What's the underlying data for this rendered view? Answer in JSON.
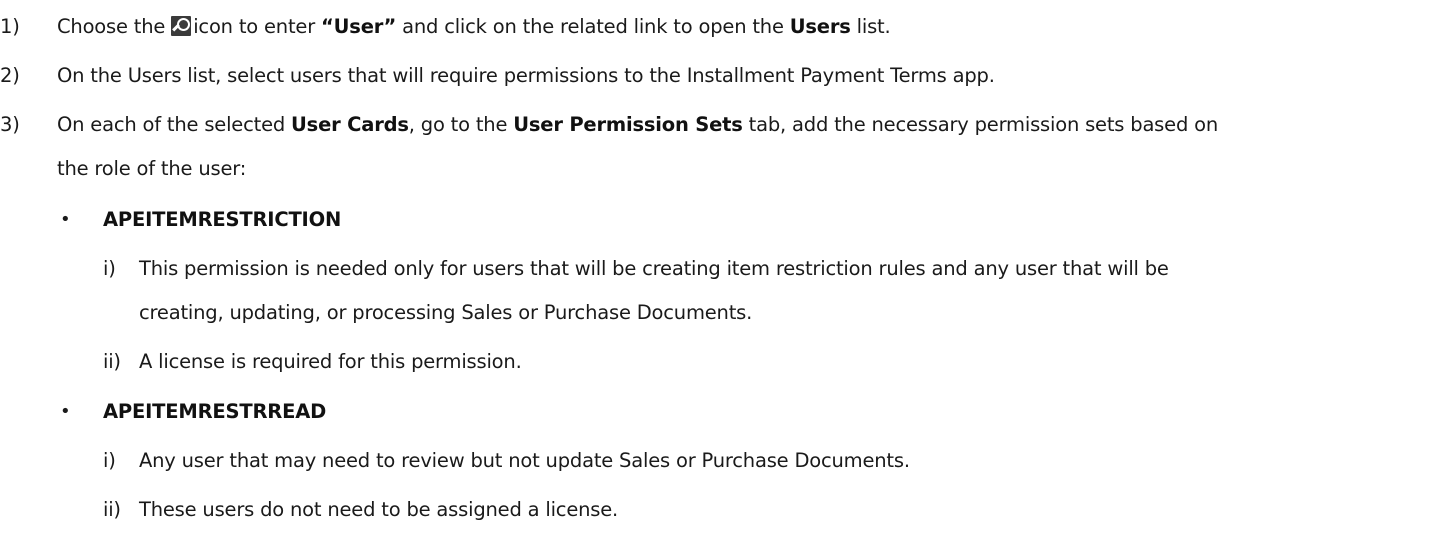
{
  "steps": {
    "s1": {
      "number": "1)",
      "t1": "Choose the",
      "icon": "search-icon",
      "t2": "icon to enter",
      "b1": "“User”",
      "t3": "and click on the related link to open the",
      "b2": "Users",
      "t4": "list."
    },
    "s2": {
      "number": "2)",
      "text": "On the Users list, select users that will require permissions to the Installment Payment Terms app."
    },
    "s3": {
      "number": "3)",
      "t1": "On each of the selected",
      "b1": "User Cards",
      "t2": ", go to the",
      "b2": "User Permission Sets",
      "t3": "tab, add the necessary permission sets based on",
      "cont": "the role of the user:"
    }
  },
  "permissions": [
    {
      "bullet": "•",
      "name": "APEITEMRESTRICTION",
      "items": [
        {
          "marker": "i)",
          "line1": "This permission is needed only for users that will be creating item restriction rules and any user that will be",
          "line2": "creating, updating, or processing Sales or Purchase Documents."
        },
        {
          "marker": "ii)",
          "line1": "A license is required for this permission."
        }
      ]
    },
    {
      "bullet": "•",
      "name": "APEITEMRESTRREAD",
      "items": [
        {
          "marker": "i)",
          "line1": "Any user that may need to review but not update Sales or Purchase Documents."
        },
        {
          "marker": "ii)",
          "line1": "These users do not need to be assigned a license."
        }
      ]
    }
  ]
}
